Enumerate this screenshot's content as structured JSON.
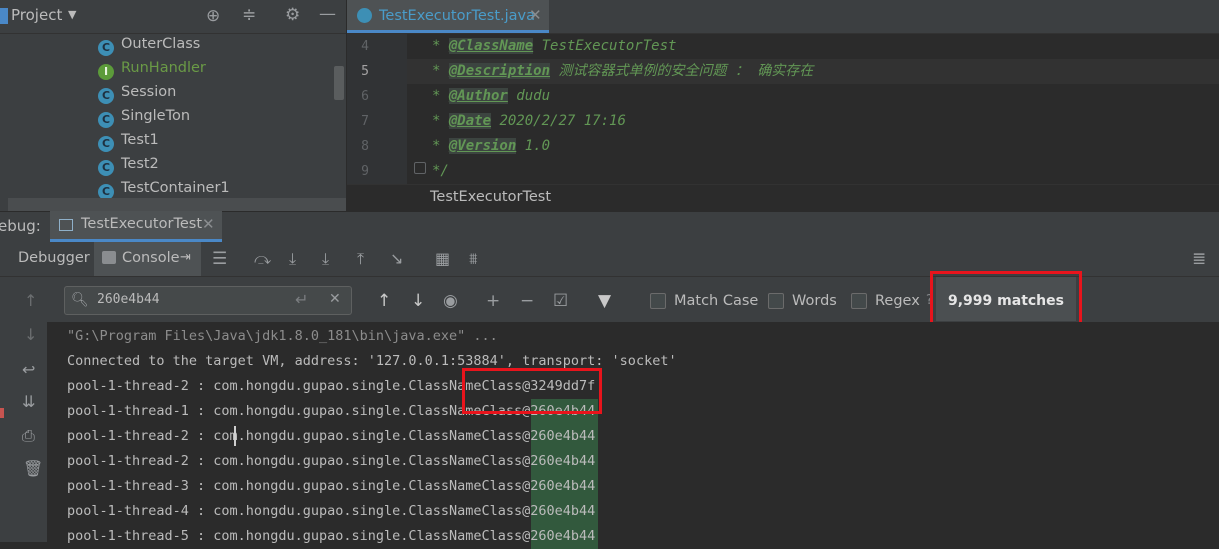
{
  "project": {
    "title": "Project",
    "items": [
      {
        "label": "OuterClass",
        "kind": "class",
        "color": "#bbbbbb"
      },
      {
        "label": "RunHandler",
        "kind": "interface",
        "color": "#6a9a46"
      },
      {
        "label": "Session",
        "kind": "class",
        "color": "#bbbbbb"
      },
      {
        "label": "SingleTon",
        "kind": "class",
        "color": "#bbbbbb"
      },
      {
        "label": "Test1",
        "kind": "class",
        "color": "#bbbbbb"
      },
      {
        "label": "Test2",
        "kind": "class",
        "color": "#bbbbbb"
      },
      {
        "label": "TestContainer1",
        "kind": "class",
        "color": "#bbbbbb"
      }
    ]
  },
  "editor": {
    "tab_label": "TestExecutorTest.java",
    "lines": [
      {
        "num": "4",
        "tag": "@ClassName",
        "text": " TestExecutorTest"
      },
      {
        "num": "5",
        "tag": "@Description",
        "text": " 测试容器式单例的安全问题 ：  确实存在"
      },
      {
        "num": "6",
        "tag": "@Author",
        "text": " dudu"
      },
      {
        "num": "7",
        "tag": "@Date",
        "text": " 2020/2/27 17:16"
      },
      {
        "num": "8",
        "tag": "@Version",
        "text": " 1.0"
      },
      {
        "num": "9",
        "tag": "",
        "text": "*/"
      }
    ],
    "breadcrumb": "TestExecutorTest"
  },
  "debug": {
    "label": "ebug:",
    "session_tab": "TestExecutorTest",
    "debugger_tab": "Debugger",
    "console_tab": "Console"
  },
  "search": {
    "query": "260e4b44",
    "match_case": "Match Case",
    "words": "Words",
    "regex": "Regex",
    "matches": "9,999 matches"
  },
  "console": {
    "lines": [
      "\"G:\\Program Files\\Java\\jdk1.8.0_181\\bin\\java.exe\" ...",
      "Connected to the target VM, address: '127.0.0.1:53884', transport: 'socket'",
      "pool-1-thread-2 : com.hongdu.gupao.single.ClassNameClass@3249dd7f",
      "pool-1-thread-1 : com.hongdu.gupao.single.ClassNameClass@260e4b44",
      "pool-1-thread-2 : com.hongdu.gupao.single.ClassNameClass@260e4b44",
      "pool-1-thread-2 : com.hongdu.gupao.single.ClassNameClass@260e4b44",
      "pool-1-thread-3 : com.hongdu.gupao.single.ClassNameClass@260e4b44",
      "pool-1-thread-4 : com.hongdu.gupao.single.ClassNameClass@260e4b44",
      "pool-1-thread-5 : com.hongdu.gupao.single.ClassNameClass@260e4b44"
    ]
  },
  "colors": {
    "accent": "#4a88c7",
    "annotation_red": "#e8141c",
    "doc_green": "#629755",
    "match_highlight": "#32593d"
  }
}
